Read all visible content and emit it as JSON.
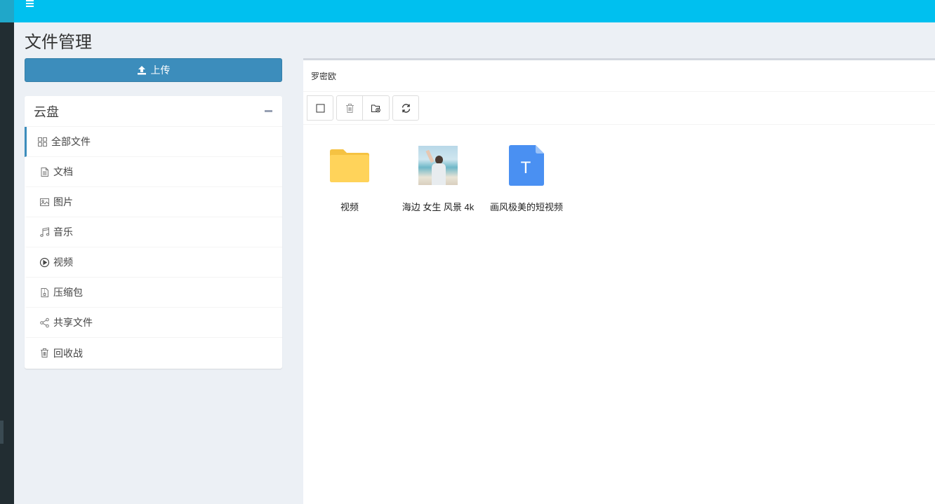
{
  "page": {
    "title": "文件管理"
  },
  "upload": {
    "label": "上传",
    "icon": "upload-icon"
  },
  "cloud": {
    "title": "云盘",
    "items": [
      {
        "label": "全部文件",
        "icon": "grid-icon",
        "active": true
      },
      {
        "label": "文档",
        "icon": "document-icon"
      },
      {
        "label": "图片",
        "icon": "image-icon"
      },
      {
        "label": "音乐",
        "icon": "music-icon"
      },
      {
        "label": "视频",
        "icon": "play-circle-icon"
      },
      {
        "label": "压缩包",
        "icon": "archive-icon"
      },
      {
        "label": "共享文件",
        "icon": "share-icon"
      },
      {
        "label": "回收战",
        "icon": "trash-icon"
      }
    ]
  },
  "main": {
    "path": "罗密欧",
    "files": [
      {
        "name": "视频",
        "type": "folder",
        "icon": "folder-icon"
      },
      {
        "name": "海边 女生 风景 4k",
        "type": "image",
        "icon": "image-thumbnail"
      },
      {
        "name": "画风极美的短视频",
        "type": "text",
        "icon": "text-file-icon",
        "letter": "T"
      }
    ]
  },
  "colors": {
    "topbar": "#00c0ef",
    "rail": "#222d32",
    "upload": "#3c8dbc",
    "folder": "#ffd35a",
    "textfile": "#4a90f2"
  }
}
